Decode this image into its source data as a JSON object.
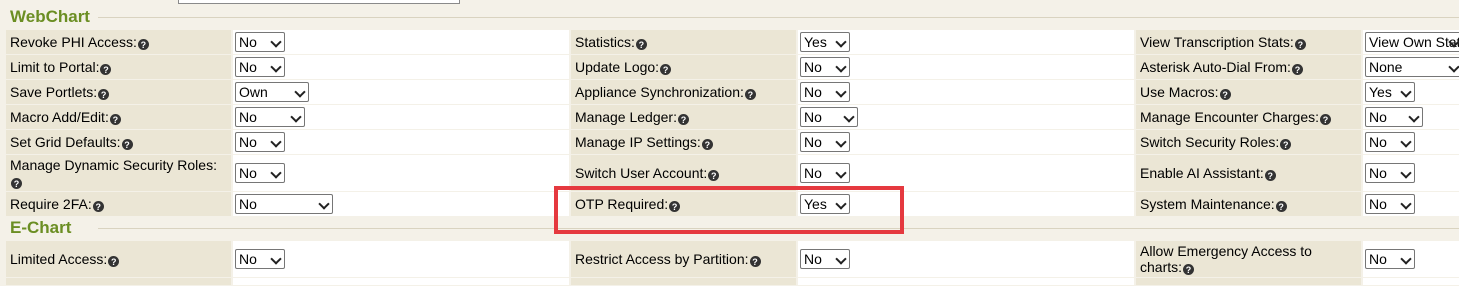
{
  "icon": "question-circle-icon",
  "help_glyph": "?",
  "highlight_color": "#e5393f",
  "sections": [
    {
      "title": "WebChart",
      "rows": [
        {
          "h": 25,
          "cols": [
            {
              "label": "Revoke PHI Access:",
              "value": "No"
            },
            {
              "label": "Statistics:",
              "value": "Yes"
            },
            {
              "label": "View Transcription Stats:",
              "value": "View Own Stats"
            }
          ]
        },
        {
          "h": 25,
          "cols": [
            {
              "label": "Limit to Portal:",
              "value": "No"
            },
            {
              "label": "Update Logo:",
              "value": "No"
            },
            {
              "label": "Asterisk Auto-Dial From:",
              "value": "None"
            }
          ]
        },
        {
          "h": 25,
          "cols": [
            {
              "label": "Save Portlets:",
              "value": "Own"
            },
            {
              "label": "Appliance Synchronization:",
              "value": "No"
            },
            {
              "label": "Use Macros:",
              "value": "Yes"
            }
          ]
        },
        {
          "h": 25,
          "cols": [
            {
              "label": "Macro Add/Edit:",
              "value": "No"
            },
            {
              "label": "Manage Ledger:",
              "value": "No"
            },
            {
              "label": "Manage Encounter Charges:",
              "value": "No"
            }
          ]
        },
        {
          "h": 25,
          "cols": [
            {
              "label": "Set Grid Defaults:",
              "value": "No"
            },
            {
              "label": "Manage IP Settings:",
              "value": "No"
            },
            {
              "label": "Switch Security Roles:",
              "value": "No"
            }
          ]
        },
        {
          "h": 37,
          "cols": [
            {
              "label": "Manage Dynamic Security Roles:",
              "value": "No"
            },
            {
              "label": "Switch User Account:",
              "value": "No"
            },
            {
              "label": "Enable AI Assistant:",
              "value": "No"
            }
          ]
        },
        {
          "h": 25,
          "cols": [
            {
              "label": "Require 2FA:",
              "value": "No"
            },
            {
              "label": "OTP Required:",
              "value": "Yes"
            },
            {
              "label": "System Maintenance:",
              "value": "No"
            }
          ]
        }
      ]
    },
    {
      "title": "E-Chart",
      "rows": [
        {
          "h": 37,
          "cols": [
            {
              "label": "Limited Access:",
              "value": "No"
            },
            {
              "label": "Restrict Access by Partition:",
              "value": "No"
            },
            {
              "label": "Allow Emergency Access to charts:",
              "value": "No"
            }
          ]
        },
        {
          "h": 8,
          "cols": [
            {
              "label": "",
              "value": ""
            },
            {
              "label": "",
              "value": ""
            },
            {
              "label": "",
              "value": ""
            }
          ]
        }
      ]
    }
  ]
}
